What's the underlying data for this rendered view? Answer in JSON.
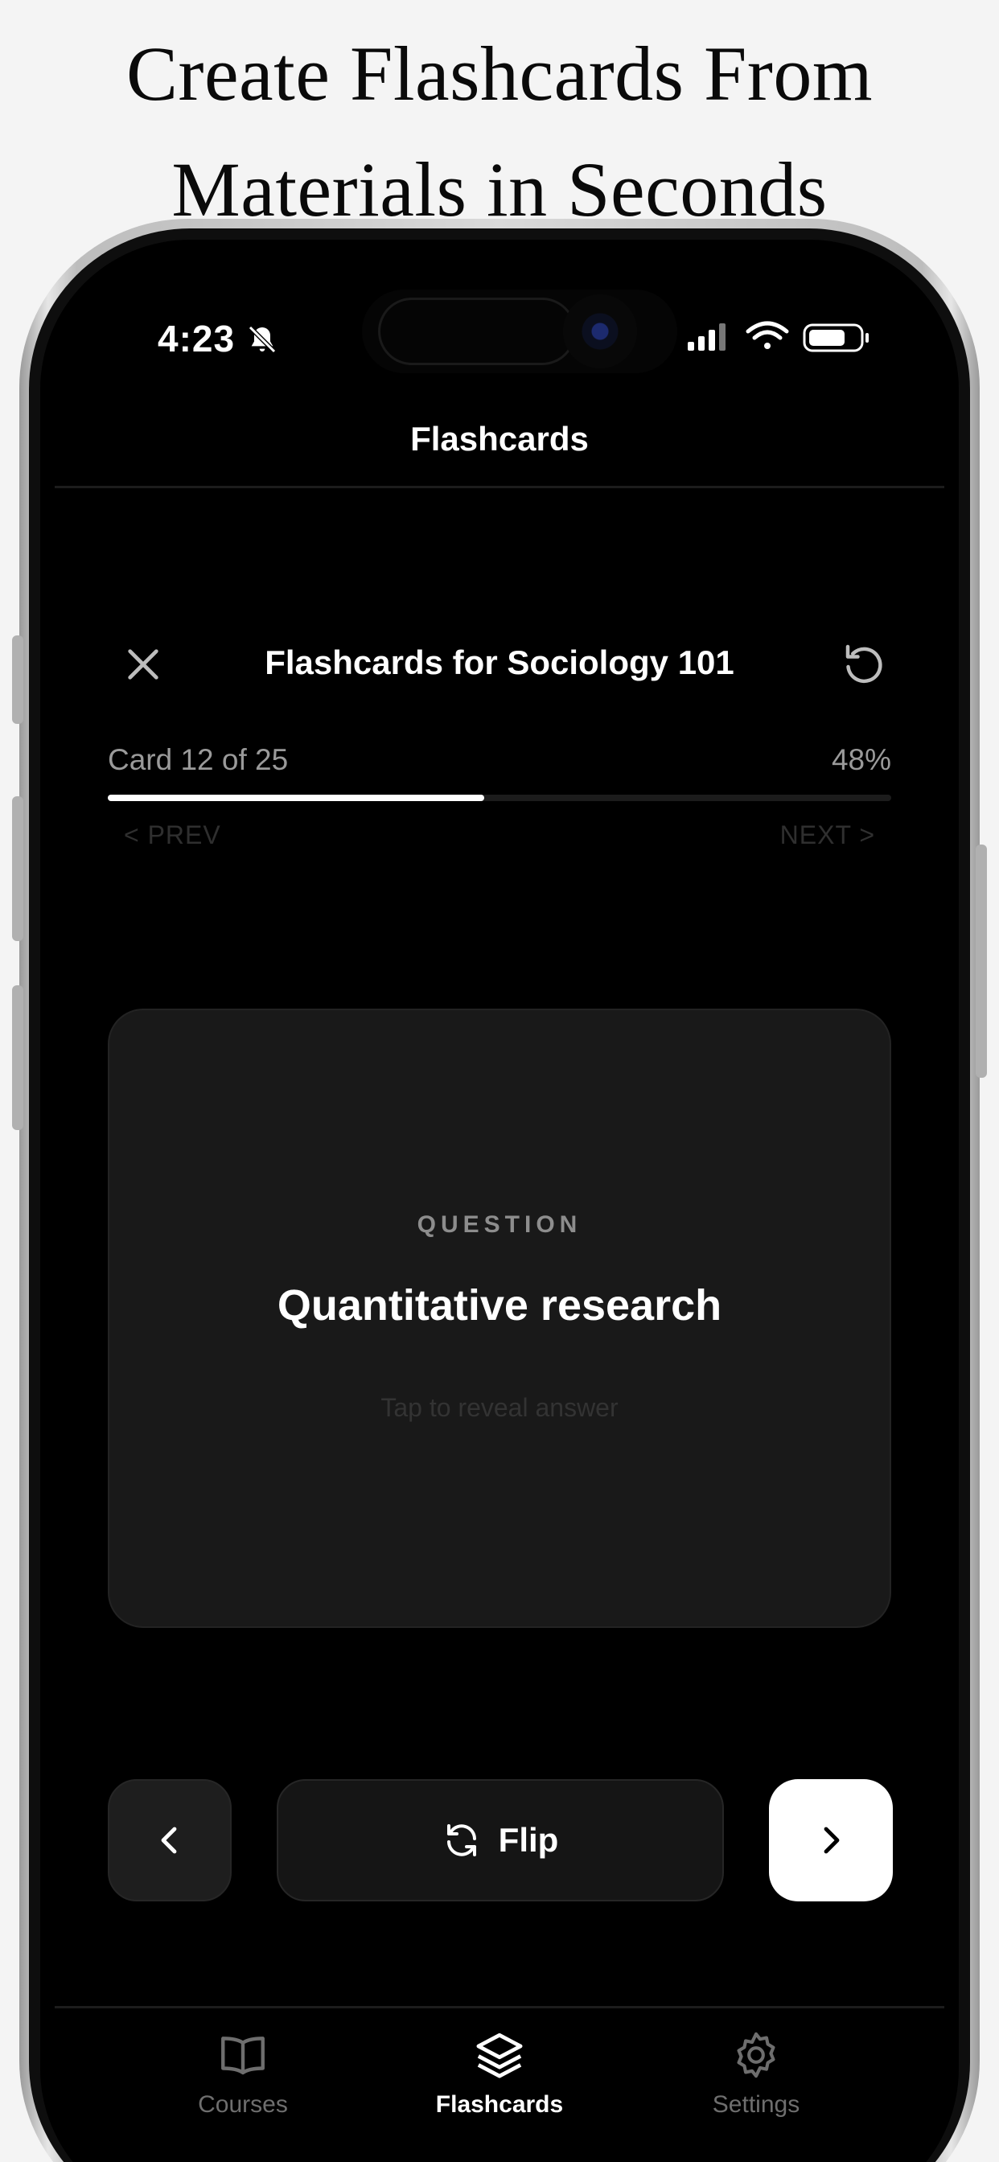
{
  "headline": {
    "line1": "Create Flashcards From",
    "line2": "Materials in Seconds"
  },
  "status_bar": {
    "time": "4:23",
    "icons": [
      "bell-slash-icon",
      "cellular-signal-icon",
      "wifi-icon",
      "battery-icon"
    ]
  },
  "nav": {
    "title": "Flashcards"
  },
  "deck": {
    "title": "Flashcards for Sociology 101",
    "close_icon": "close-icon",
    "reset_icon": "reset-icon"
  },
  "progress": {
    "card_text": "Card 12 of 25",
    "percent_text": "48%",
    "fraction": 0.48,
    "prev_label": "< PREV",
    "next_label": "NEXT >"
  },
  "card": {
    "label": "QUESTION",
    "question": "Quantitative research",
    "hint": "Tap to reveal answer"
  },
  "controls": {
    "prev_icon": "chevron-left-icon",
    "flip_label": "Flip",
    "flip_icon": "refresh-icon",
    "next_icon": "chevron-right-icon"
  },
  "tabbar": {
    "tabs": [
      {
        "label": "Courses",
        "icon": "book-icon",
        "active": false
      },
      {
        "label": "Flashcards",
        "icon": "layers-icon",
        "active": true
      },
      {
        "label": "Settings",
        "icon": "gear-icon",
        "active": false
      }
    ]
  },
  "colors": {
    "background": "#f4f4f4",
    "screen": "#000000",
    "card": "#191919",
    "accent": "#ffffff",
    "muted": "#9a9a9a"
  }
}
